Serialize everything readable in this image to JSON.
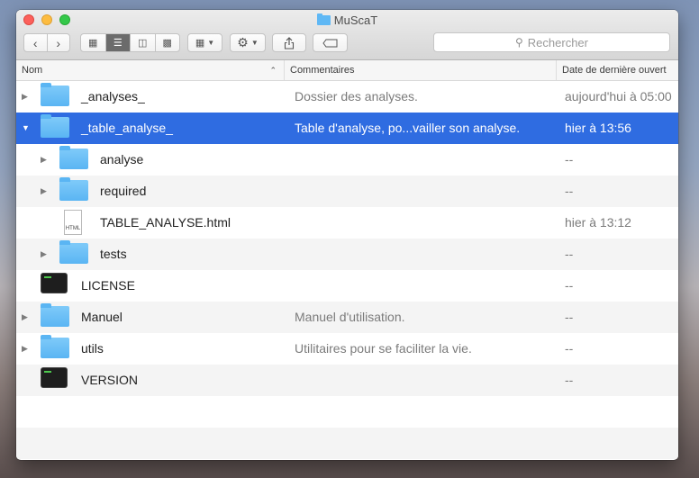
{
  "window": {
    "title": "MuScaT"
  },
  "toolbar": {
    "back_icon": "chevron-left-icon",
    "forward_icon": "chevron-right-icon",
    "view_modes": [
      "icon-view-icon",
      "list-view-icon",
      "column-view-icon",
      "gallery-view-icon"
    ],
    "active_view": "list-view-icon",
    "arrange_icon": "arrange-icon",
    "action_icon": "gear-icon",
    "share_icon": "share-icon",
    "tags_icon": "tag-icon",
    "search": {
      "placeholder": "Rechercher"
    }
  },
  "columns": {
    "name": "Nom",
    "comments": "Commentaires",
    "date": "Date de dernière ouvert"
  },
  "rows": [
    {
      "name": "_analyses_",
      "comment": "Dossier des analyses.",
      "date": "aujourd'hui à 05:00",
      "kind": "folder",
      "level": 0,
      "disclosure": "collapsed",
      "selected": false
    },
    {
      "name": "_table_analyse_",
      "comment": "Table d'analyse, po...vailler son analyse.",
      "date": "hier à 13:56",
      "kind": "folder",
      "level": 0,
      "disclosure": "expanded",
      "selected": true
    },
    {
      "name": "analyse",
      "comment": "",
      "date": "--",
      "kind": "folder",
      "level": 1,
      "disclosure": "collapsed",
      "selected": false
    },
    {
      "name": "required",
      "comment": "",
      "date": "--",
      "kind": "folder",
      "level": 1,
      "disclosure": "collapsed",
      "selected": false
    },
    {
      "name": "TABLE_ANALYSE.html",
      "comment": "",
      "date": "hier à 13:12",
      "kind": "html",
      "file_label": "HTML",
      "level": 1,
      "disclosure": "none",
      "selected": false
    },
    {
      "name": "tests",
      "comment": "",
      "date": "--",
      "kind": "folder",
      "level": 1,
      "disclosure": "collapsed",
      "selected": false
    },
    {
      "name": "LICENSE",
      "comment": "",
      "date": "--",
      "kind": "terminal",
      "level": 0,
      "disclosure": "none",
      "selected": false
    },
    {
      "name": "Manuel",
      "comment": "Manuel d'utilisation.",
      "date": "--",
      "kind": "folder",
      "level": 0,
      "disclosure": "collapsed",
      "selected": false
    },
    {
      "name": "utils",
      "comment": "Utilitaires pour se faciliter la vie.",
      "date": "--",
      "kind": "folder",
      "level": 0,
      "disclosure": "collapsed",
      "selected": false
    },
    {
      "name": "VERSION",
      "comment": "",
      "date": "--",
      "kind": "terminal",
      "level": 0,
      "disclosure": "none",
      "selected": false
    }
  ],
  "colors": {
    "selection": "#2f6ce1",
    "folder": "#5ab5f3"
  }
}
